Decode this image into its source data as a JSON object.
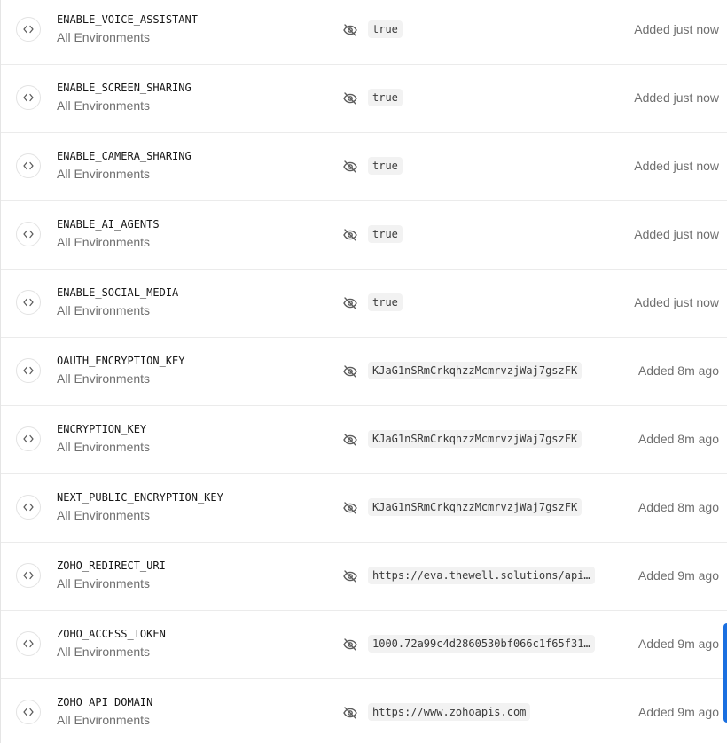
{
  "env_vars": [
    {
      "key": "ENABLE_VOICE_ASSISTANT",
      "environment": "All Environments",
      "value": "true",
      "added": "Added just now"
    },
    {
      "key": "ENABLE_SCREEN_SHARING",
      "environment": "All Environments",
      "value": "true",
      "added": "Added just now"
    },
    {
      "key": "ENABLE_CAMERA_SHARING",
      "environment": "All Environments",
      "value": "true",
      "added": "Added just now"
    },
    {
      "key": "ENABLE_AI_AGENTS",
      "environment": "All Environments",
      "value": "true",
      "added": "Added just now"
    },
    {
      "key": "ENABLE_SOCIAL_MEDIA",
      "environment": "All Environments",
      "value": "true",
      "added": "Added just now"
    },
    {
      "key": "OAUTH_ENCRYPTION_KEY",
      "environment": "All Environments",
      "value": "KJaG1nSRmCrkqhzzMcmrvzjWaj7gszFK",
      "added": "Added 8m ago"
    },
    {
      "key": "ENCRYPTION_KEY",
      "environment": "All Environments",
      "value": "KJaG1nSRmCrkqhzzMcmrvzjWaj7gszFK",
      "added": "Added 8m ago"
    },
    {
      "key": "NEXT_PUBLIC_ENCRYPTION_KEY",
      "environment": "All Environments",
      "value": "KJaG1nSRmCrkqhzzMcmrvzjWaj7gszFK",
      "added": "Added 8m ago"
    },
    {
      "key": "ZOHO_REDIRECT_URI",
      "environment": "All Environments",
      "value": "https://eva.thewell.solutions/api…",
      "added": "Added 9m ago"
    },
    {
      "key": "ZOHO_ACCESS_TOKEN",
      "environment": "All Environments",
      "value": "1000.72a99c4d2860530bf066c1f65f31…",
      "added": "Added 9m ago"
    },
    {
      "key": "ZOHO_API_DOMAIN",
      "environment": "All Environments",
      "value": "https://www.zohoapis.com",
      "added": "Added 9m ago"
    }
  ],
  "icons": {
    "row_icon": "code-brackets-icon",
    "reveal_icon": "eye-off-icon"
  },
  "colors": {
    "accent": "#1a6fe0",
    "border": "#ebebeb",
    "muted_text": "#6f6f6f",
    "value_bg": "#f2f2f2"
  }
}
